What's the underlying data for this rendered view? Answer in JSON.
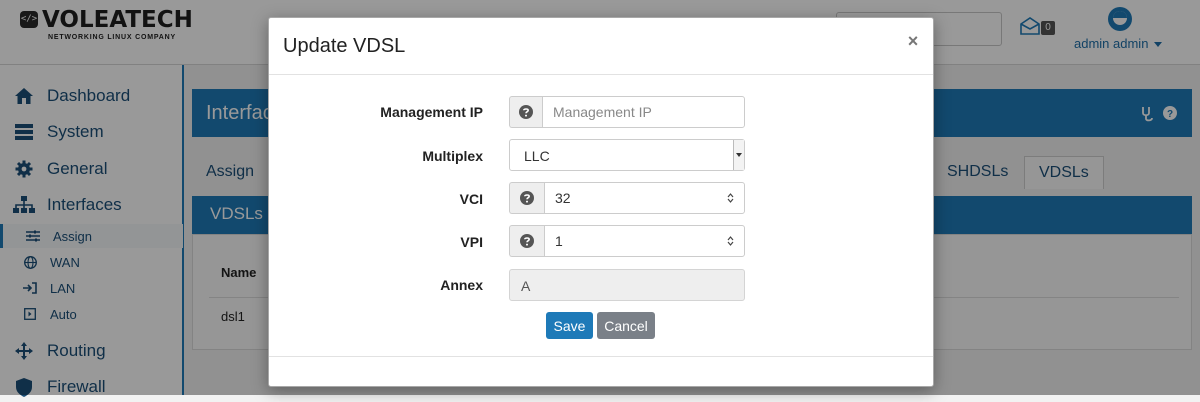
{
  "brand": {
    "name": "VOLEATECH",
    "tagline": "NETWORKING LINUX COMPANY",
    "mark": "</>"
  },
  "topbar": {
    "mail_count": "0",
    "user_label": "admin admin",
    "icons": [
      "mail-icon",
      "user-avatar-icon",
      "chevron-down-icon"
    ]
  },
  "sidebar": {
    "items": [
      {
        "label": "Dashboard",
        "icon": "home-icon"
      },
      {
        "label": "System",
        "icon": "server-icon"
      },
      {
        "label": "General",
        "icon": "gear-icon"
      },
      {
        "label": "Interfaces",
        "icon": "sitemap-icon"
      }
    ],
    "subitems": [
      {
        "label": "Assign",
        "icon": "sliders-icon",
        "active": true
      },
      {
        "label": "WAN",
        "icon": "globe-icon"
      },
      {
        "label": "LAN",
        "icon": "sign-in-icon"
      },
      {
        "label": "Auto",
        "icon": "square-icon"
      }
    ],
    "items_after": [
      {
        "label": "Routing",
        "icon": "arrows-icon"
      },
      {
        "label": "Firewall",
        "icon": "shield-icon"
      }
    ]
  },
  "main": {
    "title": "Interfaces",
    "tabs": [
      {
        "label": "Assign"
      },
      {
        "label": "SHDSLs"
      },
      {
        "label": "VDSLs",
        "active": true
      }
    ],
    "section_title": "VDSLs",
    "table": {
      "columns": [
        "Name"
      ],
      "rows": [
        [
          "dsl1"
        ]
      ]
    }
  },
  "modal": {
    "title": "Update VDSL",
    "close_label": "×",
    "fields": {
      "management_ip": {
        "label": "Management IP",
        "placeholder": "Management IP",
        "value": ""
      },
      "multiplex": {
        "label": "Multiplex",
        "value": "LLC"
      },
      "vci": {
        "label": "VCI",
        "value": "32"
      },
      "vpi": {
        "label": "VPI",
        "value": "1"
      },
      "annex": {
        "label": "Annex",
        "value": "A"
      }
    },
    "save_label": "Save",
    "cancel_label": "Cancel"
  },
  "colors": {
    "primary": "#1e7ab8",
    "cancel": "#7a8088",
    "overlay": "rgba(0,0,0,0.40)"
  }
}
